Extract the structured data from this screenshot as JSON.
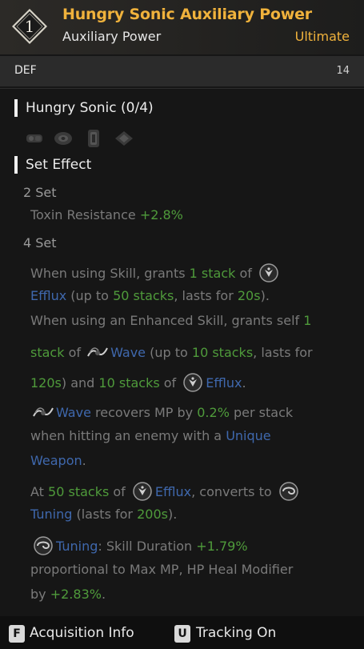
{
  "header": {
    "tier": "1",
    "title": "Hungry Sonic Auxiliary Power",
    "subtitle": "Auxiliary Power",
    "rarity": "Ultimate"
  },
  "stat": {
    "name": "DEF",
    "value": "14"
  },
  "set_section": {
    "title": "Hungry Sonic (0/4)",
    "icons": [
      "gear-part-icon-1",
      "gear-part-icon-2",
      "gear-part-icon-3",
      "gear-part-icon-4"
    ]
  },
  "effect_section": {
    "title": "Set Effect",
    "set2": {
      "label": "2 Set",
      "stat": "Toxin Resistance",
      "bonus": "+2.8%"
    },
    "set4": {
      "label": "4 Set",
      "l1_a": "When using Skill, grants",
      "l1_b": "1 stack",
      "l1_c": "of",
      "l2_a": "Efflux",
      "l2_b": "(up to",
      "l2_c": "50 stacks",
      "l2_d": ", lasts for",
      "l2_e": "20s",
      "l2_f": ").",
      "l3_a": "When using an Enhanced Skill, grants self",
      "l3_b": "1",
      "l4_a": "stack",
      "l4_b": "of",
      "l4_c": "Wave",
      "l4_d": "(up to",
      "l4_e": "10 stacks",
      "l4_f": ", lasts for",
      "l5_a": "120s",
      "l5_b": ") and",
      "l5_c": "10 stacks",
      "l5_d": "of",
      "l5_e": "Efflux",
      "l5_f": ".",
      "l6_a": "Wave",
      "l6_b": "recovers MP by",
      "l6_c": "0.2%",
      "l6_d": "per stack",
      "l7_a": "when hitting an enemy with a",
      "l7_b": "Unique",
      "l8_a": "Weapon",
      "l8_b": ".",
      "l9_a": "At",
      "l9_b": "50 stacks",
      "l9_c": "of",
      "l9_d": "Efflux",
      "l9_e": ", converts to",
      "l10_a": "Tuning",
      "l10_b": "(lasts for",
      "l10_c": "200s",
      "l10_d": ").",
      "l11_a": "Tuning",
      "l11_b": ": Skill Duration",
      "l11_c": "+1.79%",
      "l12_a": "proportional to Max MP, HP Heal Modifier",
      "l13_a": "by",
      "l13_b": "+2.83%",
      "l13_c": "."
    }
  },
  "footer": {
    "acq_key": "F",
    "acq_label": "Acquisition Info",
    "track_key": "U",
    "track_label": "Tracking On"
  },
  "colors": {
    "accent": "#f0b23c",
    "positive": "#4f9b3b",
    "keyword": "#3f68ad"
  }
}
